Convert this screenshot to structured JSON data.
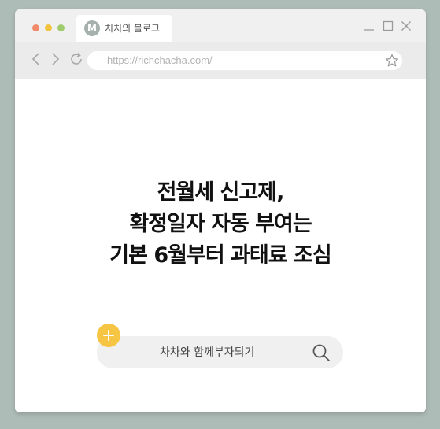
{
  "browser": {
    "tab": {
      "avatar_letter": "M",
      "title": "치치의 블로그"
    },
    "url": "https://richchacha.com/",
    "icons": {
      "back": "chevron-left-icon",
      "forward": "chevron-right-icon",
      "reload": "reload-icon",
      "bookmark": "star-icon",
      "minimize": "minimize-icon",
      "maximize": "maximize-icon",
      "close": "close-icon"
    }
  },
  "headline": {
    "line1": "전월세 신고제,",
    "line2": "확정일자 자동 부여는",
    "line3": "기본 6월부터 과태료 조심"
  },
  "search": {
    "text": "차차와 함께부자되기",
    "plus_icon": "plus-icon",
    "search_icon": "search-icon"
  },
  "colors": {
    "background": "#aebcb8",
    "plus_accent": "#f6c544",
    "traffic_red": "#f08a6a",
    "traffic_yellow": "#f1c33e",
    "traffic_green": "#9ecb6b"
  }
}
